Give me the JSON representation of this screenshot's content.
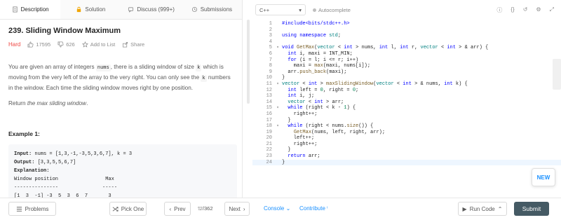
{
  "tabs": [
    {
      "label": "Description",
      "icon": "document-icon"
    },
    {
      "label": "Solution",
      "icon": "lock-icon"
    },
    {
      "label": "Discuss (999+)",
      "icon": "chat-icon"
    },
    {
      "label": "Submissions",
      "icon": "history-icon"
    }
  ],
  "problem": {
    "title": "239. Sliding Window Maximum",
    "difficulty": "Hard",
    "likes": "17595",
    "dislikes": "626",
    "add_to_list": "Add to List",
    "share": "Share",
    "desc1_a": "You are given an array of integers ",
    "desc1_code1": "nums",
    "desc1_b": ", there is a sliding window of size ",
    "desc1_code2": "k",
    "desc1_c": " which is moving from the very left of the array to the very right. You can only see the ",
    "desc1_code3": "k",
    "desc1_d": " numbers in the window. Each time the sliding window moves right by one position.",
    "desc2_a": "Return ",
    "desc2_em": "the max sliding window",
    "desc2_b": ".",
    "example_title": "Example 1:",
    "example": {
      "input_label": "Input:",
      "input": " nums = [1,3,-1,-3,5,3,6,7], k = 3",
      "output_label": "Output:",
      "output": " [3,3,5,5,6,7]",
      "explanation_label": "Explanation:",
      "header": "Window position                Max",
      "divider": "---------------               -----",
      "row1": "[1  3  -1] -3  5  3  6  7       3"
    }
  },
  "editor": {
    "language": "C++",
    "autocomplete": "Autocomplete",
    "toolbar_icons": [
      "info-icon",
      "braces-icon",
      "reset-icon",
      "settings-icon",
      "fullscreen-icon"
    ],
    "lines": [
      {
        "n": "1",
        "fold": "",
        "code": "#include<bits/stdc++.h>"
      },
      {
        "n": "2",
        "fold": "",
        "code": ""
      },
      {
        "n": "3",
        "fold": "",
        "code": "using namespace std;"
      },
      {
        "n": "4",
        "fold": "",
        "code": ""
      },
      {
        "n": "5",
        "fold": "▾",
        "code": "void GetMax(vector < int > nums, int l, int r, vector < int > & arr) {"
      },
      {
        "n": "6",
        "fold": "",
        "code": "  int i, maxi = INT_MIN;"
      },
      {
        "n": "7",
        "fold": "",
        "code": "  for (i = l; i <= r; i++)"
      },
      {
        "n": "8",
        "fold": "",
        "code": "    maxi = max(maxi, nums[i]);"
      },
      {
        "n": "9",
        "fold": "",
        "code": "  arr.push_back(maxi);"
      },
      {
        "n": "10",
        "fold": "",
        "code": "}"
      },
      {
        "n": "11",
        "fold": "▾",
        "code": "vector < int > maxSlidingWindow(vector < int > & nums, int k) {"
      },
      {
        "n": "12",
        "fold": "",
        "code": "  int left = 0, right = 0;"
      },
      {
        "n": "13",
        "fold": "",
        "code": "  int i, j;"
      },
      {
        "n": "14",
        "fold": "",
        "code": "  vector < int > arr;"
      },
      {
        "n": "15",
        "fold": "▾",
        "code": "  while (right < k - 1) {"
      },
      {
        "n": "16",
        "fold": "",
        "code": "    right++;"
      },
      {
        "n": "17",
        "fold": "",
        "code": "  }"
      },
      {
        "n": "18",
        "fold": "▾",
        "code": "  while (right < nums.size()) {"
      },
      {
        "n": "19",
        "fold": "",
        "code": "    GetMax(nums, left, right, arr);"
      },
      {
        "n": "20",
        "fold": "",
        "code": "    left++;"
      },
      {
        "n": "21",
        "fold": "",
        "code": "    right++;"
      },
      {
        "n": "22",
        "fold": "",
        "code": "  }"
      },
      {
        "n": "23",
        "fold": "",
        "code": "  return arr;"
      },
      {
        "n": "24",
        "fold": "",
        "code": "}"
      }
    ],
    "new_badge": "NEW"
  },
  "bottom": {
    "problems": "Problems",
    "pick_one": "Pick One",
    "prev": "Prev",
    "page": "/362",
    "next": "Next",
    "console": "Console",
    "contribute": "Contribute",
    "run_code": "Run Code",
    "submit": "Submit"
  },
  "colors": {
    "hard": "#ef4743",
    "link": "#1a90ff",
    "submit_bg": "#455a64"
  }
}
